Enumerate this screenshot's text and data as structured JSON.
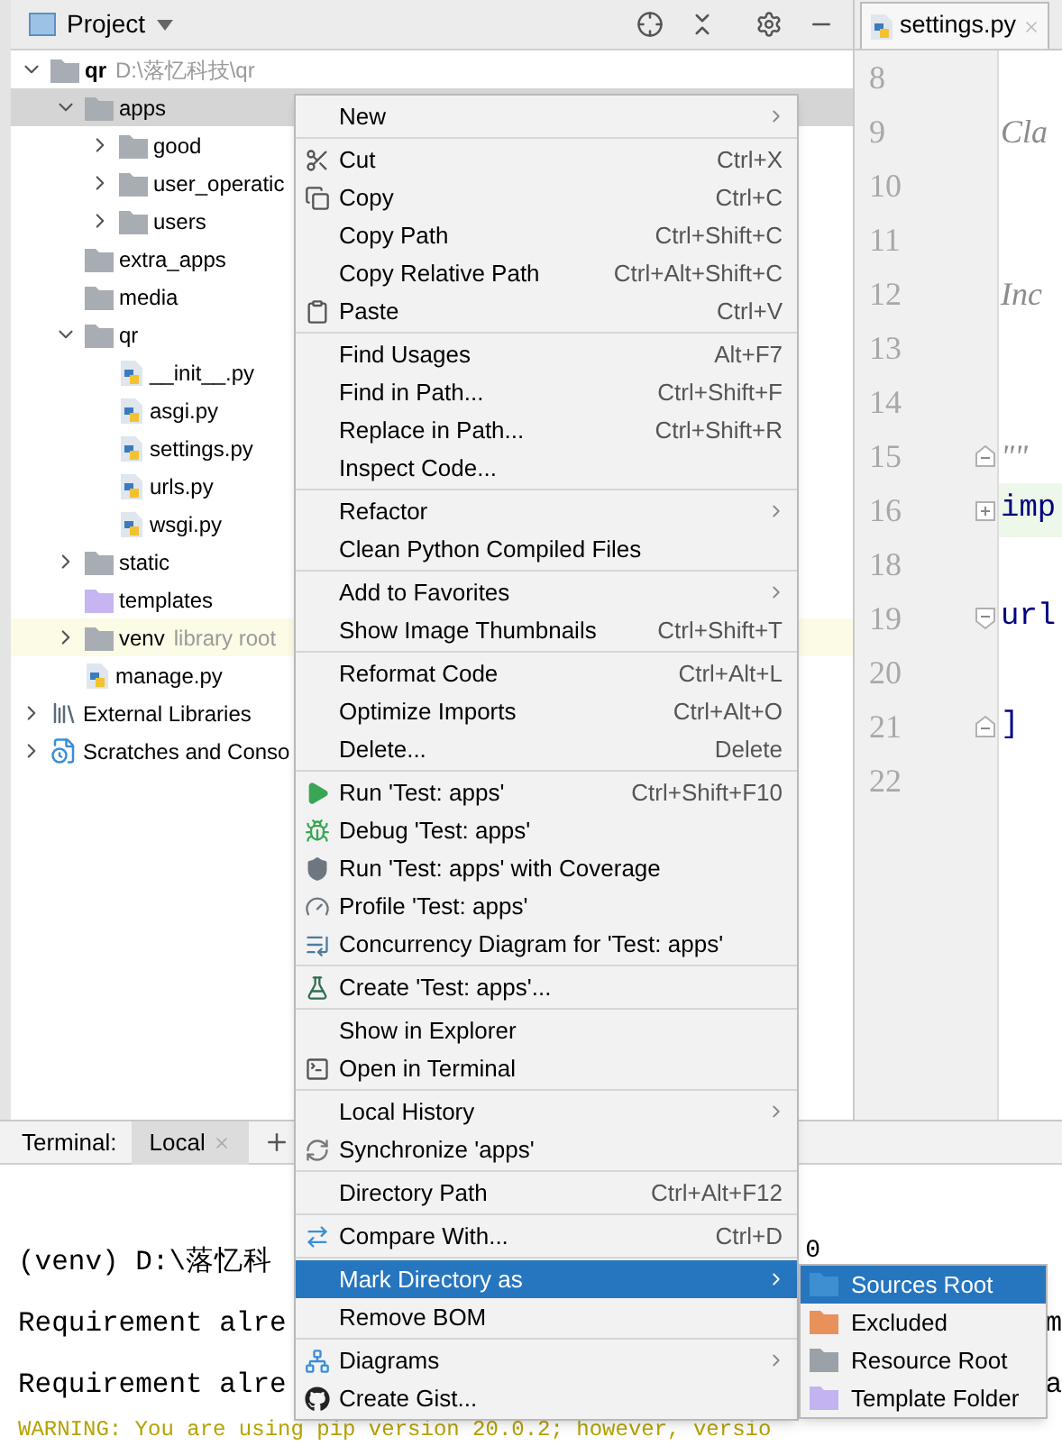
{
  "project_panel": {
    "title": "Project",
    "tree": [
      {
        "label": "qr",
        "hint": "D:\\落忆科技\\qr",
        "kind": "folder",
        "bold": true,
        "expanded": true,
        "selected": false,
        "children": [
          {
            "label": "apps",
            "kind": "folder",
            "expanded": true,
            "selected": true,
            "children": [
              {
                "label": "good",
                "kind": "folder",
                "expanded": false,
                "selected": false
              },
              {
                "label": "user_operatic",
                "kind": "folder",
                "expanded": false,
                "selected": false
              },
              {
                "label": "users",
                "kind": "folder",
                "expanded": false,
                "selected": false
              }
            ]
          },
          {
            "label": "extra_apps",
            "kind": "folder",
            "selected": false
          },
          {
            "label": "media",
            "kind": "folder",
            "selected": false
          },
          {
            "label": "qr",
            "kind": "folder",
            "expanded": true,
            "selected": false,
            "children": [
              {
                "label": "__init__.py",
                "kind": "python",
                "selected": false
              },
              {
                "label": "asgi.py",
                "kind": "python",
                "selected": false
              },
              {
                "label": "settings.py",
                "kind": "python",
                "selected": false
              },
              {
                "label": "urls.py",
                "kind": "python",
                "selected": false
              },
              {
                "label": "wsgi.py",
                "kind": "python",
                "selected": false
              }
            ]
          },
          {
            "label": "static",
            "kind": "folder",
            "expanded": false,
            "selected": false
          },
          {
            "label": "templates",
            "kind": "template_folder",
            "selected": false
          },
          {
            "label": "venv",
            "hint": "library root",
            "kind": "folder",
            "expanded": false,
            "selected": false,
            "highlighted": true
          },
          {
            "label": "manage.py",
            "kind": "python",
            "selected": false
          }
        ]
      },
      {
        "label": "External Libraries",
        "kind": "library",
        "expanded": false,
        "selected": false
      },
      {
        "label": "Scratches and Conso",
        "kind": "scratches",
        "expanded": false,
        "selected": false
      }
    ]
  },
  "editor": {
    "tab": {
      "label": "settings.py",
      "selected": true
    },
    "lines": [
      {
        "number": "8",
        "highlighted": false
      },
      {
        "number": "9",
        "code": "Cla",
        "kind": "docstring",
        "highlighted": false
      },
      {
        "number": "10",
        "highlighted": false
      },
      {
        "number": "11",
        "highlighted": false
      },
      {
        "number": "12",
        "code": "Inc",
        "kind": "docstring",
        "highlighted": false
      },
      {
        "number": "13",
        "highlighted": false
      },
      {
        "number": "14",
        "highlighted": false
      },
      {
        "number": "15",
        "code": "\"\"",
        "kind": "docstring",
        "fold_end": true,
        "highlighted": false
      },
      {
        "number": "16",
        "code": "imp",
        "kind": "code",
        "folded": true,
        "highlighted": true
      },
      {
        "number": "18",
        "highlighted": false
      },
      {
        "number": "19",
        "code": "url",
        "kind": "code",
        "fold_start": true,
        "highlighted": false
      },
      {
        "number": "20",
        "highlighted": false
      },
      {
        "number": "21",
        "code": "]",
        "kind": "code",
        "fold_end": true,
        "highlighted": false
      },
      {
        "number": "22",
        "highlighted": false
      }
    ]
  },
  "terminal": {
    "label": "Terminal:",
    "tabs": [
      {
        "label": "Local",
        "selected": true
      }
    ],
    "lines": [
      {
        "text": "(venv) D:\\落忆科",
        "tail": "0",
        "kind": "normal"
      },
      {
        "text": "Requirement alre",
        "tail": "m",
        "kind": "normal"
      },
      {
        "text": "Requirement alre",
        "tail": "a",
        "kind": "normal"
      },
      {
        "text": "WARNING: You are using pip version 20.0.2; however, versio",
        "kind": "warning"
      }
    ]
  },
  "context_menu": {
    "groups": [
      [
        {
          "label": "New",
          "submenu": true,
          "selected": false
        }
      ],
      [
        {
          "label": "Cut",
          "kind": "scissors",
          "shortcut": "Ctrl+X",
          "selected": false
        },
        {
          "label": "Copy",
          "kind": "copy",
          "shortcut": "Ctrl+C",
          "selected": false
        },
        {
          "label": "Copy Path",
          "shortcut": "Ctrl+Shift+C",
          "selected": false
        },
        {
          "label": "Copy Relative Path",
          "shortcut": "Ctrl+Alt+Shift+C",
          "selected": false
        },
        {
          "label": "Paste",
          "kind": "paste",
          "shortcut": "Ctrl+V",
          "selected": false
        }
      ],
      [
        {
          "label": "Find Usages",
          "shortcut": "Alt+F7",
          "selected": false
        },
        {
          "label": "Find in Path...",
          "shortcut": "Ctrl+Shift+F",
          "selected": false
        },
        {
          "label": "Replace in Path...",
          "shortcut": "Ctrl+Shift+R",
          "selected": false
        },
        {
          "label": "Inspect Code...",
          "selected": false
        }
      ],
      [
        {
          "label": "Refactor",
          "submenu": true,
          "selected": false
        },
        {
          "label": "Clean Python Compiled Files",
          "selected": false
        }
      ],
      [
        {
          "label": "Add to Favorites",
          "submenu": true,
          "selected": false
        },
        {
          "label": "Show Image Thumbnails",
          "shortcut": "Ctrl+Shift+T",
          "selected": false
        }
      ],
      [
        {
          "label": "Reformat Code",
          "shortcut": "Ctrl+Alt+L",
          "selected": false
        },
        {
          "label": "Optimize Imports",
          "shortcut": "Ctrl+Alt+O",
          "selected": false
        },
        {
          "label": "Delete...",
          "shortcut": "Delete",
          "selected": false
        }
      ],
      [
        {
          "label": "Run 'Test: apps'",
          "kind": "run",
          "shortcut": "Ctrl+Shift+F10",
          "selected": false
        },
        {
          "label": "Debug 'Test: apps'",
          "kind": "debug",
          "selected": false
        },
        {
          "label": "Run 'Test: apps' with Coverage",
          "kind": "coverage",
          "selected": false
        },
        {
          "label": "Profile 'Test: apps'",
          "kind": "profile",
          "selected": false
        },
        {
          "label": "Concurrency Diagram for 'Test: apps'",
          "kind": "concurrency",
          "selected": false
        }
      ],
      [
        {
          "label": "Create 'Test: apps'...",
          "kind": "create_test",
          "selected": false
        }
      ],
      [
        {
          "label": "Show in Explorer",
          "selected": false
        },
        {
          "label": "Open in Terminal",
          "kind": "terminal",
          "selected": false
        }
      ],
      [
        {
          "label": "Local History",
          "submenu": true,
          "selected": false
        },
        {
          "label": "Synchronize 'apps'",
          "kind": "sync",
          "selected": false
        }
      ],
      [
        {
          "label": "Directory Path",
          "shortcut": "Ctrl+Alt+F12",
          "selected": false
        }
      ],
      [
        {
          "label": "Compare With...",
          "kind": "compare",
          "shortcut": "Ctrl+D",
          "selected": false
        }
      ],
      [
        {
          "label": "Mark Directory as",
          "submenu": true,
          "selected": true
        },
        {
          "label": "Remove BOM",
          "selected": false
        }
      ],
      [
        {
          "label": "Diagrams",
          "kind": "diagram",
          "submenu": true,
          "selected": false
        },
        {
          "label": "Create Gist...",
          "kind": "github",
          "selected": false
        }
      ]
    ]
  },
  "submenu": {
    "items": [
      {
        "label": "Sources Root",
        "color": "#3d8fd1",
        "selected": true
      },
      {
        "label": "Excluded",
        "color": "#e8915a",
        "selected": false
      },
      {
        "label": "Resource Root",
        "color": "#9aa1a8",
        "selected": false
      },
      {
        "label": "Template Folder",
        "color": "#c3b3f0",
        "selected": false
      }
    ]
  }
}
